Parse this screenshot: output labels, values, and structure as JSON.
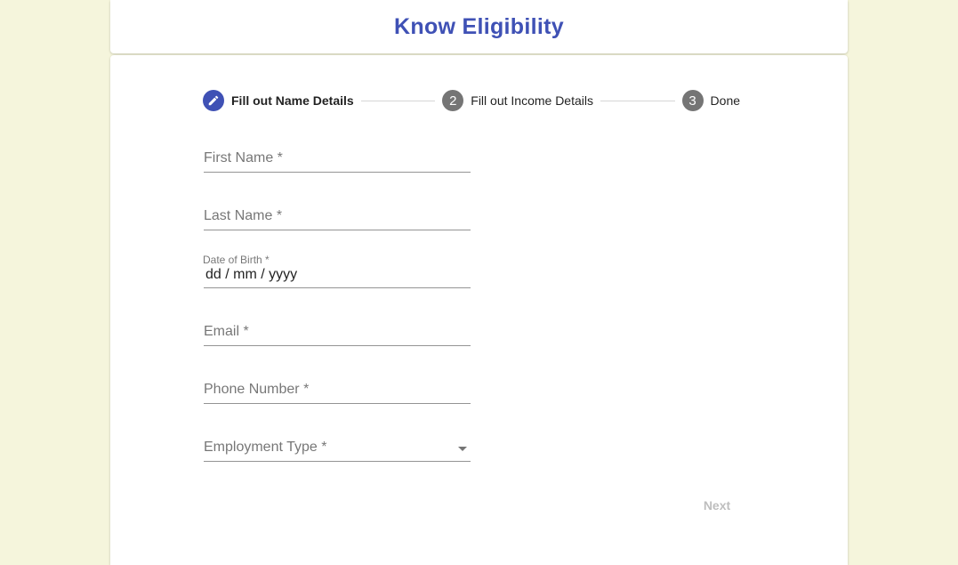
{
  "header": {
    "title": "Know Eligibility",
    "accent_color": "#3f51b5",
    "background_color": "#f5f5dc"
  },
  "stepper": {
    "steps": [
      {
        "index": "1",
        "label": "Fill out Name Details",
        "state": "active",
        "icon": "edit-icon"
      },
      {
        "index": "2",
        "label": "Fill out Income Details",
        "state": "inactive"
      },
      {
        "index": "3",
        "label": "Done",
        "state": "inactive"
      }
    ]
  },
  "form": {
    "first_name": {
      "placeholder": "First Name *",
      "value": ""
    },
    "last_name": {
      "placeholder": "Last Name *",
      "value": ""
    },
    "date_of_birth": {
      "label": "Date of Birth *",
      "value": "dd / mm / yyyy"
    },
    "email": {
      "placeholder": "Email *",
      "value": ""
    },
    "phone_number": {
      "placeholder": "Phone Number *",
      "value": ""
    },
    "employment_type": {
      "placeholder": "Employment Type *",
      "selected": "",
      "icon": "arrow-drop-down-icon"
    }
  },
  "actions": {
    "next_label": "Next",
    "next_enabled": false
  }
}
